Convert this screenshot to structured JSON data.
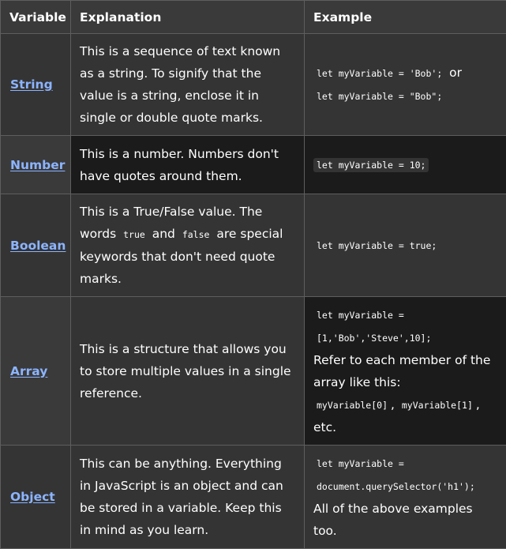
{
  "headers": {
    "variable": "Variable",
    "explanation": "Explanation",
    "example": "Example"
  },
  "rows": [
    {
      "name": "String",
      "explanation": "This is a sequence of text known as a string. To signify that the value is a string, enclose it in single or double quote marks.",
      "example_code_1": "let myVariable = 'Bob';",
      "example_text_1": " or",
      "example_code_2": "let myVariable = \"Bob\";"
    },
    {
      "name": "Number",
      "explanation": "This is a number. Numbers don't have quotes around them.",
      "example_code_1": "let myVariable = 10;"
    },
    {
      "name": "Boolean",
      "explanation_1": "This is a True/False value. The words ",
      "explanation_code_1": "true",
      "explanation_2": " and ",
      "explanation_code_2": "false",
      "explanation_3": " are special keywords that don't need quote marks.",
      "example_code_1": "let myVariable = true;"
    },
    {
      "name": "Array",
      "explanation": "This is a structure that allows you to store multiple values in a single reference.",
      "example_code_1": "let myVariable =",
      "example_code_2": "[1,'Bob','Steve',10];",
      "example_text_1": "Refer to each member of the array like this:",
      "example_code_3": "myVariable[0]",
      "example_text_2": ", ",
      "example_code_4": "myVariable[1]",
      "example_text_3": ",",
      "example_text_4": "etc."
    },
    {
      "name": "Object",
      "explanation": "This can be anything. Everything in JavaScript is an object and can be stored in a variable. Keep this in mind as you learn.",
      "example_code_1": "let myVariable =",
      "example_code_2": "document.querySelector('h1');",
      "example_text_1": "All of the above examples too."
    }
  ]
}
